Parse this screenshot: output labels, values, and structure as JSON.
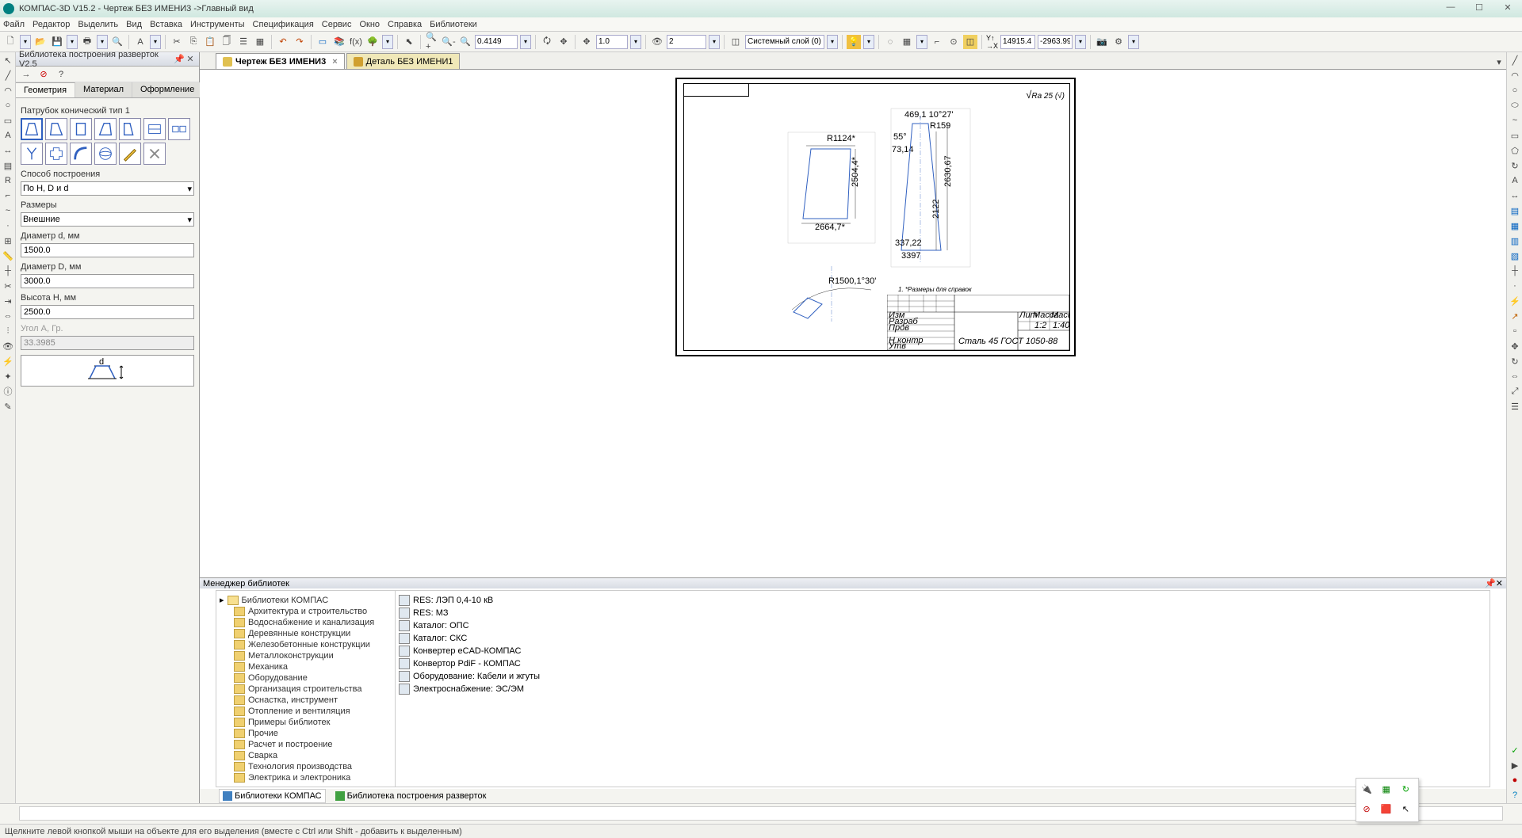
{
  "window": {
    "title": "КОМПАС-3D V15.2 - Чертеж БЕЗ ИМЕНИ3 ->Главный вид"
  },
  "menu": [
    "Файл",
    "Редактор",
    "Выделить",
    "Вид",
    "Вставка",
    "Инструменты",
    "Спецификация",
    "Сервис",
    "Окно",
    "Справка",
    "Библиотеки"
  ],
  "toolbar": {
    "zoom_value": "0.4149",
    "scale_value": "1.0",
    "count_value": "2",
    "layer_value": "Системный слой (0)",
    "coord_x": "14915.4",
    "coord_y": "-2963.99"
  },
  "side_panel": {
    "title": "Библиотека построения разверток V2.5",
    "tabs": [
      "Геометрия",
      "Материал",
      "Оформление"
    ],
    "active_tab": 0,
    "part_label": "Патрубок конический тип 1",
    "build_method_label": "Способ построения",
    "build_method_value": "По H, D и d",
    "sizes_label": "Размеры",
    "sizes_value": "Внешние",
    "diam_d_label": "Диаметр d, мм",
    "diam_d_value": "1500.0",
    "diam_D_label": "Диаметр D, мм",
    "diam_D_value": "3000.0",
    "height_label": "Высота H, мм",
    "height_value": "2500.0",
    "angle_label": "Угол А, Гр.",
    "angle_value": "33.3985"
  },
  "doc_tabs": [
    {
      "label": "Чертеж БЕЗ ИМЕНИ3",
      "active": true
    },
    {
      "label": "Деталь БЕЗ ИМЕНИ1",
      "active": false
    }
  ],
  "drawing": {
    "surface_note": "Ra 25 (√)",
    "note1": "1. *Размеры для справок",
    "stamp_material": "Сталь 45 ГОСТ 1050-88",
    "stamp_scale": "1:2",
    "stamp_format": "1:40",
    "dim1": "2664,7*",
    "dim2": "R1124*",
    "dim3": "2504,4*",
    "dim4": "469,1 10°27'",
    "dim5": "55°",
    "dim6": "R159",
    "dim7": "73,14",
    "dim8": "337,22",
    "dim9": "3397",
    "dim10": "2630,67",
    "dim11": "2122",
    "arc_dim": "R1500,1°30'"
  },
  "lib_manager": {
    "title": "Менеджер библиотек",
    "root": "Библиотеки КОМПАС",
    "folders": [
      "Архитектура и строительство",
      "Водоснабжение и канализация",
      "Деревянные конструкции",
      "Железобетонные конструкции",
      "Металлоконструкции",
      "Механика",
      "Оборудование",
      "Организация строительства",
      "Оснастка, инструмент",
      "Отопление и вентиляция",
      "Примеры библиотек",
      "Прочие",
      "Расчет и построение",
      "Сварка",
      "Технология производства",
      "Электрика и электроника"
    ],
    "items": [
      "RES: ЛЭП 0,4-10 кВ",
      "RES: МЗ",
      "Каталог: ОПС",
      "Каталог: СКС",
      "Конвертер eCAD-КОМПАС",
      "Конвертор PdiF - КОМПАС",
      "Оборудование: Кабели и жгуты",
      "Электроснабжение: ЭС/ЭМ"
    ],
    "bottom_tabs": [
      "Библиотеки КОМПАС",
      "Библиотека построения разверток"
    ]
  },
  "status": "Щелкните левой кнопкой мыши на объекте для его выделения (вместе с Ctrl или Shift - добавить к выделенным)"
}
